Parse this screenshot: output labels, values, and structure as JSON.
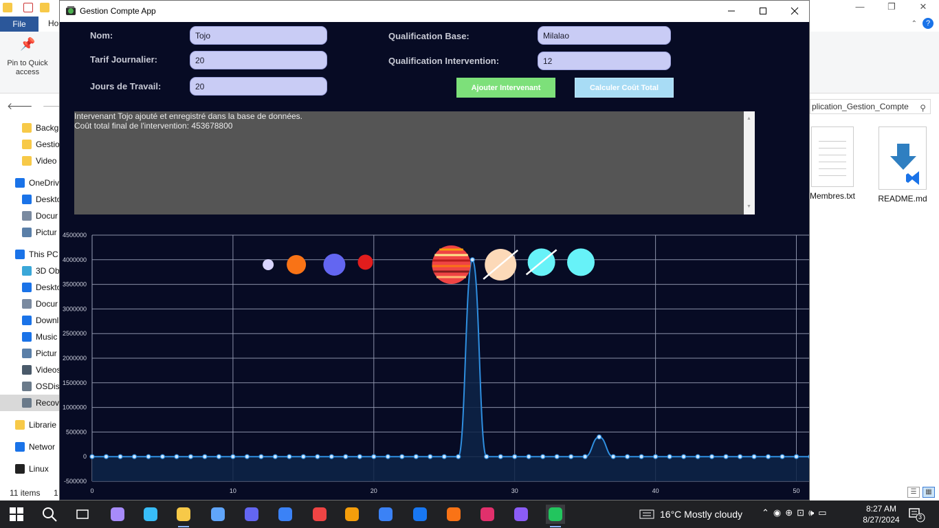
{
  "explorer": {
    "window_controls": {
      "minimize": "—",
      "maximize": "❐",
      "close": "✕"
    },
    "ribbon_tabs": {
      "file": "File",
      "home": "Ho"
    },
    "pin_label": "Pin to Quick access",
    "search_text": "plication_Gestion_Compte",
    "tree_items": [
      {
        "label": "Backg",
        "icon": "folder-icon",
        "color": "#f7c948"
      },
      {
        "label": "Gestio",
        "icon": "folder-icon",
        "color": "#f7c948"
      },
      {
        "label": "Video",
        "icon": "folder-icon",
        "color": "#f7c948"
      },
      {
        "label": "OneDriv",
        "icon": "cloud-icon",
        "color": "#1a73e8"
      },
      {
        "label": "Deskto",
        "icon": "desktop-icon",
        "color": "#1a73e8"
      },
      {
        "label": "Docur",
        "icon": "document-icon",
        "color": "#7a8aa0"
      },
      {
        "label": "Pictur",
        "icon": "picture-icon",
        "color": "#5a7fa8"
      },
      {
        "label": "This PC",
        "icon": "computer-icon",
        "color": "#1a73e8"
      },
      {
        "label": "3D Ob",
        "icon": "cube-icon",
        "color": "#3aa7d8"
      },
      {
        "label": "Deskto",
        "icon": "desktop-icon",
        "color": "#1a73e8"
      },
      {
        "label": "Docur",
        "icon": "document-icon",
        "color": "#7a8aa0"
      },
      {
        "label": "Downl",
        "icon": "download-icon",
        "color": "#1a73e8"
      },
      {
        "label": "Music",
        "icon": "music-icon",
        "color": "#1a73e8"
      },
      {
        "label": "Pictur",
        "icon": "picture-icon",
        "color": "#5a7fa8"
      },
      {
        "label": "Videos",
        "icon": "film-icon",
        "color": "#4a5a6a"
      },
      {
        "label": "OSDis",
        "icon": "drive-icon",
        "color": "#6a7a8a"
      },
      {
        "label": "Recov",
        "icon": "drive-icon",
        "color": "#6a7a8a"
      },
      {
        "label": "Librarie",
        "icon": "library-icon",
        "color": "#f7c948"
      },
      {
        "label": "Networ",
        "icon": "network-icon",
        "color": "#1a73e8"
      },
      {
        "label": "Linux",
        "icon": "penguin-icon",
        "color": "#222222"
      }
    ],
    "files": [
      {
        "name": "Membres.txt"
      },
      {
        "name": "README.md"
      }
    ],
    "status_count": "11 items",
    "status_extra": "1"
  },
  "app": {
    "title": "Gestion Compte App",
    "window_controls": {
      "minimize": "—",
      "maximize": "☐",
      "close": "✕"
    },
    "form": {
      "nom_label": "Nom:",
      "nom_value": "Tojo",
      "tarif_label": "Tarif Journalier:",
      "tarif_value": "20",
      "jours_label": "Jours de Travail:",
      "jours_value": "20",
      "qual_base_label": "Qualification Base:",
      "qual_base_value": "Milalao",
      "qual_int_label": "Qualification Intervention:",
      "qual_int_value": "12"
    },
    "buttons": {
      "add": "Ajouter Intervenant",
      "calc": "Calculer Coût Total"
    },
    "log": [
      "Intervenant Tojo ajouté et enregistré dans la base de données.",
      "Coût total final de l'intervention: 453678800"
    ],
    "colors": {
      "background": "#070b24",
      "line": "#2f8fe0",
      "area": "#0d2448",
      "grid": "#9aa0b8",
      "button_add": "#7de07a",
      "button_calc": "#a8dcf5"
    }
  },
  "chart_data": {
    "type": "area",
    "title": "",
    "xlabel": "",
    "ylabel": "",
    "xlim": [
      0,
      51
    ],
    "ylim": [
      -500000,
      4500000
    ],
    "x_ticks": [
      "0",
      "10",
      "20",
      "30",
      "40",
      "50"
    ],
    "y_ticks": [
      "-500000",
      "0",
      "500000",
      "1000000",
      "1500000",
      "2000000",
      "2500000",
      "3000000",
      "3500000",
      "4000000",
      "4500000"
    ],
    "grid": true,
    "legend": "none",
    "series": [
      {
        "values": [
          {
            "x": 0,
            "y": 0
          },
          {
            "x": 1,
            "y": 0
          },
          {
            "x": 2,
            "y": 0
          },
          {
            "x": 3,
            "y": 0
          },
          {
            "x": 4,
            "y": 0
          },
          {
            "x": 5,
            "y": 0
          },
          {
            "x": 6,
            "y": 0
          },
          {
            "x": 7,
            "y": 0
          },
          {
            "x": 8,
            "y": 0
          },
          {
            "x": 9,
            "y": 0
          },
          {
            "x": 10,
            "y": 0
          },
          {
            "x": 11,
            "y": 0
          },
          {
            "x": 12,
            "y": 0
          },
          {
            "x": 13,
            "y": 0
          },
          {
            "x": 14,
            "y": 0
          },
          {
            "x": 15,
            "y": 0
          },
          {
            "x": 16,
            "y": 0
          },
          {
            "x": 17,
            "y": 0
          },
          {
            "x": 18,
            "y": 0
          },
          {
            "x": 19,
            "y": 0
          },
          {
            "x": 20,
            "y": 0
          },
          {
            "x": 21,
            "y": 0
          },
          {
            "x": 22,
            "y": 0
          },
          {
            "x": 23,
            "y": 0
          },
          {
            "x": 24,
            "y": 0
          },
          {
            "x": 25,
            "y": 0
          },
          {
            "x": 26,
            "y": 0
          },
          {
            "x": 27,
            "y": 4000000
          },
          {
            "x": 28,
            "y": 0
          },
          {
            "x": 29,
            "y": 0
          },
          {
            "x": 30,
            "y": 0
          },
          {
            "x": 31,
            "y": 0
          },
          {
            "x": 32,
            "y": 0
          },
          {
            "x": 33,
            "y": 0
          },
          {
            "x": 34,
            "y": 0
          },
          {
            "x": 35,
            "y": 0
          },
          {
            "x": 36,
            "y": 400000
          },
          {
            "x": 37,
            "y": 0
          },
          {
            "x": 38,
            "y": 0
          },
          {
            "x": 39,
            "y": 0
          },
          {
            "x": 40,
            "y": 0
          },
          {
            "x": 41,
            "y": 0
          },
          {
            "x": 42,
            "y": 0
          },
          {
            "x": 43,
            "y": 0
          },
          {
            "x": 44,
            "y": 0
          },
          {
            "x": 45,
            "y": 0
          },
          {
            "x": 46,
            "y": 0
          },
          {
            "x": 47,
            "y": 0
          },
          {
            "x": 48,
            "y": 0
          },
          {
            "x": 49,
            "y": 0
          },
          {
            "x": 50,
            "y": 0
          },
          {
            "x": 51,
            "y": 0
          }
        ]
      }
    ],
    "decorations": [
      {
        "name": "planet-mercury",
        "x": 12.5,
        "y": 3900000,
        "r": 8,
        "color": "#d8d4ff"
      },
      {
        "name": "planet-venus",
        "x": 14.5,
        "y": 3900000,
        "r": 14,
        "color": "#f97316"
      },
      {
        "name": "planet-earth",
        "x": 17.2,
        "y": 3900000,
        "r": 16,
        "color": "#6366f1"
      },
      {
        "name": "planet-mars",
        "x": 19.4,
        "y": 3950000,
        "r": 11,
        "color": "#e11d1d"
      },
      {
        "name": "planet-jupiter",
        "x": 25.5,
        "y": 3900000,
        "r": 28,
        "color": "#ef4444"
      },
      {
        "name": "planet-saturn",
        "x": 29.0,
        "y": 3900000,
        "r": 23,
        "color": "#fcd9b8"
      },
      {
        "name": "planet-uranus",
        "x": 31.9,
        "y": 3950000,
        "r": 20,
        "color": "#67f2f8"
      },
      {
        "name": "planet-neptune",
        "x": 34.7,
        "y": 3950000,
        "r": 20,
        "color": "#67f2f8"
      }
    ]
  },
  "taskbar": {
    "apps": [
      {
        "name": "start-icon",
        "color": "#ffffff"
      },
      {
        "name": "search-icon",
        "color": "#ffffff"
      },
      {
        "name": "task-view-icon",
        "color": "#ffffff"
      },
      {
        "name": "copilot-icon",
        "color": "#a78bfa"
      },
      {
        "name": "edge-icon",
        "color": "#38bdf8"
      },
      {
        "name": "file-explorer-icon",
        "color": "#f7c948"
      },
      {
        "name": "store-icon",
        "color": "#60a5fa"
      },
      {
        "name": "media-icon",
        "color": "#6366f1"
      },
      {
        "name": "mail-icon",
        "color": "#3b82f6"
      },
      {
        "name": "chrome-icon",
        "color": "#ef4444"
      },
      {
        "name": "video-editor-icon",
        "color": "#f59e0b"
      },
      {
        "name": "todo-icon",
        "color": "#3b82f6"
      },
      {
        "name": "facebook-icon",
        "color": "#1877f2"
      },
      {
        "name": "firefox-icon",
        "color": "#f97316"
      },
      {
        "name": "instagram-icon",
        "color": "#e1306c"
      },
      {
        "name": "visual-studio-icon",
        "color": "#8b5cf6"
      },
      {
        "name": "gestion-app-icon",
        "color": "#22c55e"
      }
    ],
    "weather": "16°C  Mostly cloudy",
    "time": "8:27 AM",
    "date": "8/27/2024",
    "notifications": "3"
  }
}
